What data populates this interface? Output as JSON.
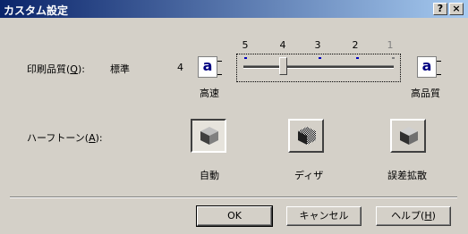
{
  "window": {
    "title": "カスタム設定",
    "help_button": "?",
    "close_button": "×"
  },
  "print_quality": {
    "label": "印刷品質(",
    "label_key": "Q",
    "label_tail": "):",
    "current_value": "標準",
    "current_level": "4",
    "scale": [
      "5",
      "4",
      "3",
      "2",
      "1"
    ],
    "selected_index": 1,
    "left_caption": "高速",
    "right_caption": "高品質",
    "icon_letter": "a"
  },
  "halftone": {
    "label": "ハーフトーン(",
    "label_key": "A",
    "label_tail": "):",
    "options": [
      {
        "label": "自動",
        "icon": "auto-halftone-cube-icon",
        "selected": true
      },
      {
        "label": "ディザ",
        "icon": "dither-cube-icon",
        "selected": false
      },
      {
        "label": "誤差拡散",
        "icon": "error-diffusion-cube-icon",
        "selected": false
      }
    ]
  },
  "buttons": {
    "ok": "OK",
    "cancel": "キャンセル",
    "help": "ヘルプ(",
    "help_key": "H",
    "help_tail": ")"
  },
  "colors": {
    "face": "#d4d0c8",
    "titlebar_start": "#0a246a",
    "titlebar_end": "#a6caf0",
    "tick_active": "#0000c0"
  }
}
